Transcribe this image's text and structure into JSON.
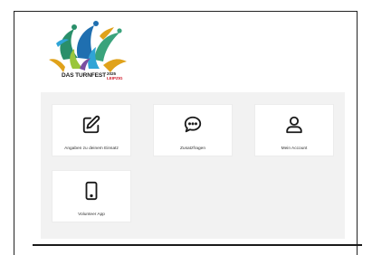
{
  "logo": {
    "title": "DAS TURNFEST",
    "year": "2025",
    "city": "LEIPZIG"
  },
  "tiles": [
    {
      "label": "Angaben zu deinem Einsatz",
      "icon": "edit-icon"
    },
    {
      "label": "Zusatzfragen",
      "icon": "chat-bubble-icon"
    },
    {
      "label": "Mein Account",
      "icon": "user-icon"
    },
    {
      "label": "Volunteer App",
      "icon": "smartphone-icon"
    }
  ],
  "colors": {
    "panel_background": "#f2f2f2",
    "tile_background": "#ffffff",
    "accent_red": "#d11a2a",
    "icon_color": "#1a1a1a"
  }
}
